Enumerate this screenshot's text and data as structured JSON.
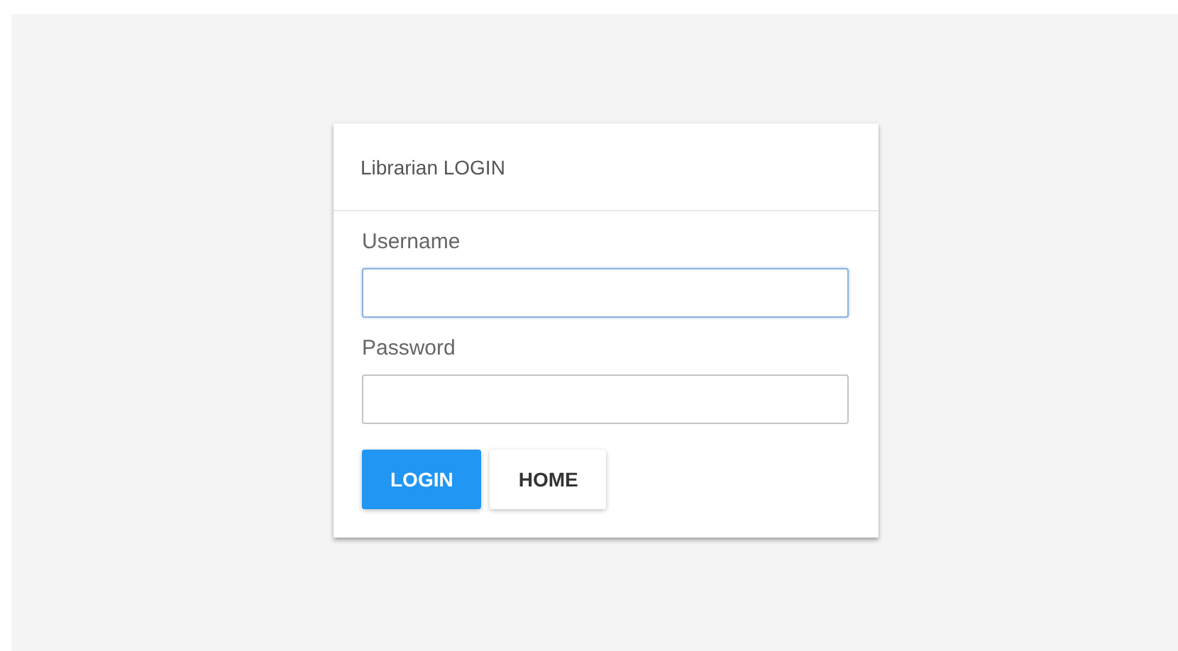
{
  "card": {
    "title": "Librarian LOGIN"
  },
  "fields": [
    {
      "label": "Username",
      "focused": true
    },
    {
      "label": "Password",
      "focused": false
    }
  ],
  "buttons": [
    {
      "label": "LOGIN",
      "kind": "primary"
    },
    {
      "label": "HOME",
      "kind": "default"
    }
  ]
}
